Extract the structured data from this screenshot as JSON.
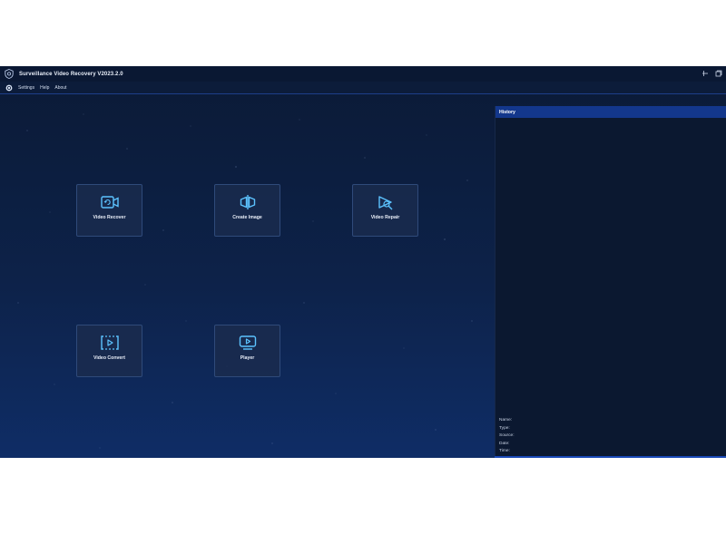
{
  "window": {
    "title": "Surveillance Video Recovery V2023.2.0",
    "controls": [
      "minimize-icon",
      "restore-icon"
    ]
  },
  "menu": {
    "items": [
      "Settings",
      "Help",
      "About"
    ]
  },
  "tiles": [
    {
      "label": "Video Recover",
      "icon": "video-recover-icon"
    },
    {
      "label": "Create Image",
      "icon": "create-image-icon"
    },
    {
      "label": "Video Repair",
      "icon": "video-repair-icon"
    },
    {
      "label": "Video Convert",
      "icon": "video-convert-icon"
    },
    {
      "label": "Player",
      "icon": "player-icon"
    }
  ],
  "history": {
    "title": "History",
    "fields": [
      "Name:",
      "Type:",
      "Source:",
      "Date:",
      "Time:"
    ]
  },
  "colors": {
    "accent": "#13378c",
    "icon": "#5cc3ff",
    "background": "#0d2249"
  }
}
